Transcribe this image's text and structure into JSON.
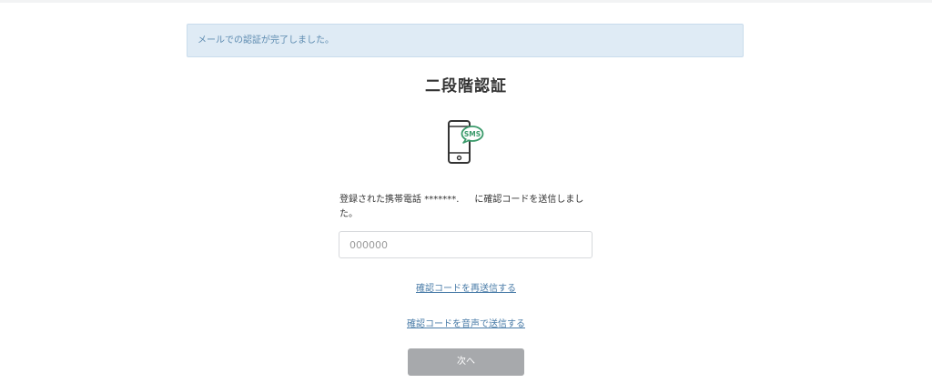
{
  "alert": {
    "message": "メールでの認証が完了しました。"
  },
  "page": {
    "title": "二段階認証"
  },
  "icon": {
    "name": "smartphone-sms-icon",
    "badge_text": "SMS",
    "accent_color": "#3a9a6a"
  },
  "description": {
    "prefix": "登録された携帯電話",
    "masked_number": "*******.",
    "suffix": "に確認コードを送信しました。"
  },
  "code_input": {
    "placeholder": "000000",
    "value": ""
  },
  "links": {
    "resend": "確認コードを再送信する",
    "voice": "確認コードを音声で送信する"
  },
  "next_button": {
    "label": "次へ",
    "color": "#a7a9ac"
  }
}
